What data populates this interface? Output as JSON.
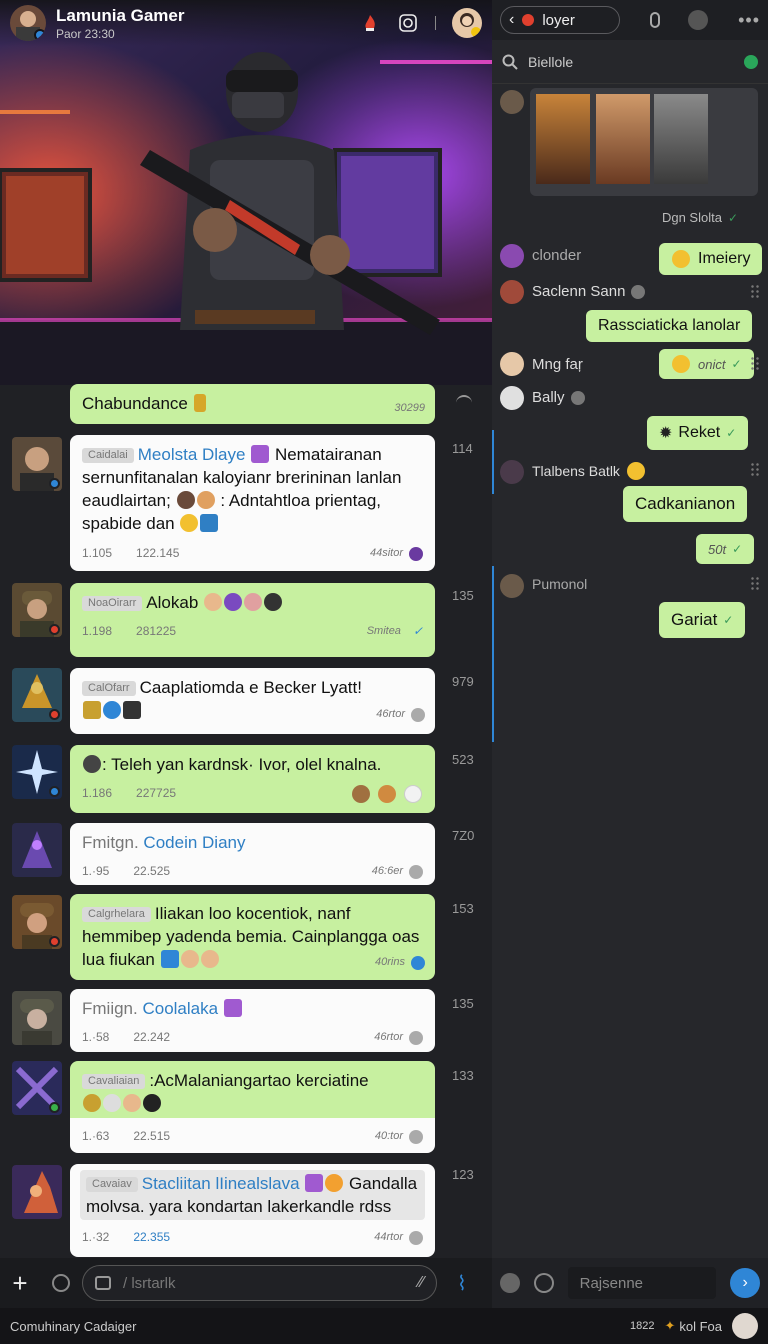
{
  "left_header": {
    "title": "Lamunia Gamer",
    "subtitle": "Paor 23:30",
    "icons": [
      "flame-icon",
      "instagram-icon",
      "profile-avatar"
    ]
  },
  "messages": [
    {
      "id": "m1",
      "style": "green",
      "text": "Chabundance",
      "time": "30299",
      "status": "read"
    },
    {
      "id": "m2",
      "style": "white",
      "count": "114",
      "tag": "Caidalai",
      "name": "Meolsta Dlaye",
      "text": "Nematairanan sernunfitanalan kaloyianr brerininan lanlan eaudlairtan;",
      "text2": ": Adntahtloa prientag, spabide dan",
      "meta_a": "1.105",
      "meta_b": "122.145",
      "meta_right": "44sitor"
    },
    {
      "id": "m3",
      "style": "green",
      "count": "135",
      "tag": "NoaOirarr",
      "text": "Alokab",
      "meta_a": "1.198",
      "meta_b": "281225",
      "meta_right": "Smitea"
    },
    {
      "id": "m4",
      "style": "white",
      "count": "979",
      "tag": "CalOfarr",
      "text": "Caaplatiomda e Becker Lyatt!",
      "meta_right": "46rtor"
    },
    {
      "id": "m5",
      "style": "green",
      "count": "523",
      "text": ": Teleh yan kardnsk· Ivor, olel knalna.",
      "meta_a": "1.186",
      "meta_b": "227725"
    },
    {
      "id": "m6",
      "style": "white",
      "count": "7Z0",
      "name_prefix": "Fmitgn.",
      "name": "Codein Diany",
      "meta_a": "1.·95",
      "meta_b": "22.525",
      "meta_right": "46:6er"
    },
    {
      "id": "m7",
      "style": "green",
      "count": "153",
      "tag": "Calgrhelara",
      "text": "Iliakan loo kocentiok, nanf hemmibep yadenda bemia. Cainplangga oas lua fiukan",
      "meta_right": "40rins"
    },
    {
      "id": "m8",
      "style": "white",
      "count": "135",
      "name_prefix": "Fmiign.",
      "name": "Coolalaka",
      "meta_a": "1.·58",
      "meta_b": "22.242",
      "meta_right": "46rtor"
    },
    {
      "id": "m9",
      "style": "green",
      "count": "133",
      "tag": "Cavaliaian",
      "text": ":AcMalaniangartao kerciatine",
      "meta_a": "1.·63",
      "meta_b": "22.515",
      "meta_right": "40:tor"
    },
    {
      "id": "m10",
      "style": "white",
      "count": "123",
      "tag": "Cavaiav",
      "name": "Stacliitan lIinealslava",
      "text": "Gandalla molvsa. yara kondartan lakerkandle rdss",
      "meta_a": "1.·32",
      "meta_b": "22.355",
      "meta_right": "44rtor"
    }
  ],
  "right_header": {
    "back_label": "loyer",
    "search_label": "Biellole"
  },
  "right_messages": {
    "gallery_caption": "Dgn Slolta",
    "items": [
      {
        "sender": "clonder",
        "bubble": "Imeiery"
      },
      {
        "sender": "Saclenn Sann",
        "bubble": "Rassciaticka lanolar"
      },
      {
        "sender": "Mng faŗ",
        "bubble": "onict"
      },
      {
        "sender": "Bally",
        "bubble": "Reket"
      },
      {
        "sender": "Tlalbens Batlk",
        "bubble": "Cadkanianon"
      },
      {
        "sender": "",
        "bubble": "50t"
      },
      {
        "sender": "Pumonol",
        "bubble": "Gariat"
      }
    ]
  },
  "composer": {
    "placeholder": "/ lsrtarlk",
    "right_placeholder": "Rajsenne"
  },
  "footer": {
    "left_text": "Comuhinary Cadaiger",
    "right_time": "1822",
    "right_label": "kol Foa"
  },
  "colors": {
    "bubble_green": "#c7f0a0",
    "bubble_white": "#fbfbfb",
    "name_blue": "#2f7fc4",
    "send_blue": "#2f86d6"
  }
}
